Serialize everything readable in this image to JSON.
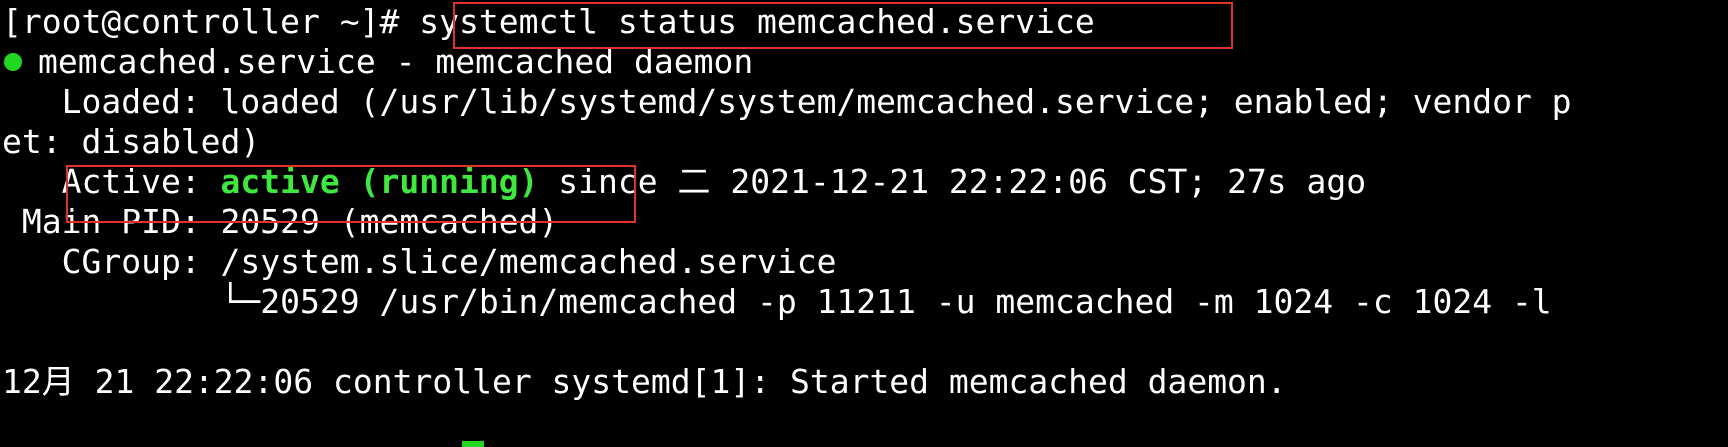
{
  "terminal": {
    "prompt": "[root@controller ~]# ",
    "command": "systemctl status memcached.service",
    "service_line": "memcached.service - memcached daemon",
    "loaded_line": "   Loaded: loaded (/usr/lib/systemd/system/memcached.service; enabled; vendor p",
    "loaded_wrap": "et: disabled)",
    "active_label": "   Active: ",
    "active_status": "active (running)",
    "active_since": " since 二 2021-12-21 22:22:06 CST; 27s ago",
    "main_pid": " Main PID: 20529 (memcached)",
    "cgroup": "   CGroup: /system.slice/memcached.service",
    "cgroup_process": "           └─20529 /usr/bin/memcached -p 11211 -u memcached -m 1024 -c 1024 -l",
    "log_line": "12月 21 22:22:06 controller systemd[1]: Started memcached daemon."
  },
  "colors": {
    "background": "#000000",
    "text": "#ffffff",
    "active_green": "#3ee83e",
    "status_dot": "#22d622",
    "annotation_red": "#e0312b",
    "cursor": "#22d622"
  },
  "icons": {
    "status_dot": "status-dot-icon"
  }
}
